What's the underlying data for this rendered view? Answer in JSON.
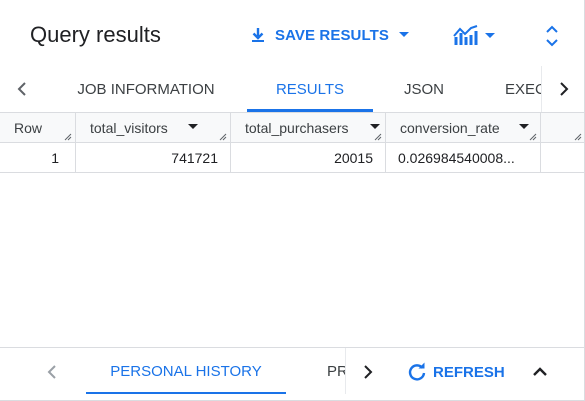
{
  "header": {
    "title": "Query results",
    "save_results_label": "SAVE RESULTS",
    "accent_color": "#1a73e8"
  },
  "icons": {
    "save": "download-icon",
    "chart": "explore-chart-icon",
    "expand": "unfold-more-icon",
    "refresh": "refresh-icon",
    "collapse": "chevron-up-icon"
  },
  "tabs": [
    {
      "label": "JOB INFORMATION",
      "active": false
    },
    {
      "label": "RESULTS",
      "active": true
    },
    {
      "label": "JSON",
      "active": false
    },
    {
      "label": "EXECUTION DETAILS",
      "active": false
    }
  ],
  "table": {
    "columns": [
      "Row",
      "total_visitors",
      "total_purchasers",
      "conversion_rate"
    ],
    "rows": [
      {
        "row": "1",
        "total_visitors": "741721",
        "total_purchasers": "20015",
        "conversion_rate": "0.026984540008..."
      }
    ]
  },
  "bottom": {
    "tabs": [
      {
        "label": "PERSONAL HISTORY",
        "active": true
      },
      {
        "label": "PROJECT HISTORY",
        "active": false
      }
    ],
    "refresh_label": "REFRESH"
  }
}
